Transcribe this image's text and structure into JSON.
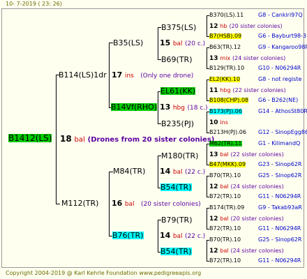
{
  "header": {
    "date": "10-  7-2019 ( 23: 26)"
  },
  "footer": {
    "copyright": "Copyright 2004-2019 @ Karl Kehrle Foundation    www.pedigreeapis.org"
  },
  "colors": {
    "yellow": "#ffff00",
    "green": "#00cc00",
    "cyan": "#00ffff",
    "info_red": "#cc0000",
    "info_purple": "#5a00a0",
    "right_blue": "#0000cc"
  },
  "gen1": {
    "name": "B1412(LS)",
    "num": "18",
    "sep": "bal",
    "note": "(Drones from 20 sister colonies)"
  },
  "gen2": [
    {
      "name": "B114(LS)1dr",
      "num": "17",
      "sep": "ins",
      "note": "(Only one drone)"
    },
    {
      "name": "M112(TR)",
      "num": "16",
      "sep": "bal",
      "note": "(20 sister colonies)"
    }
  ],
  "gen3": [
    {
      "name": "B35(LS)",
      "num": "15",
      "sep": "bal",
      "note": "(20 c.)"
    },
    {
      "name": "B14Vf(RHO)",
      "num": "13",
      "sep": "hbg",
      "note": "(18 c.)"
    },
    {
      "name": "M84(TR)",
      "num": "14",
      "sep": "bal",
      "note": "(22 c.)"
    },
    {
      "name": "B76(TR)",
      "num": "14",
      "sep": "bal",
      "note": "(22 c.)"
    }
  ],
  "gen4": [
    {
      "name": "B375(LS)",
      "num": "12",
      "sep": "hb",
      "note": "(20 sister colonies)"
    },
    {
      "name": "B69(TR)",
      "num": "13",
      "sep": "mix",
      "note": "(24 sister colonies)"
    },
    {
      "name": "EL61(KK)",
      "num": "11",
      "sep": "hbg",
      "note": "(22 sister colonies)"
    },
    {
      "name": "B235(PJ)",
      "num": "10",
      "sep": "ins",
      "note": ""
    },
    {
      "name": "M180(TR)",
      "num": "13",
      "sep": "bal",
      "note": "(22 sister colonies)"
    },
    {
      "name": "B54(TR)",
      "num": "12",
      "sep": "bal",
      "note": "(24 sister colonies)"
    },
    {
      "name": "B79(TR)",
      "num": "12",
      "sep": "bal",
      "note": "(20 sister colonies)"
    },
    {
      "name": "B54(TR)",
      "num": "12",
      "sep": "bal",
      "note": "(24 sister colonies)"
    }
  ],
  "gen5": [
    {
      "name": "B370(LS).11",
      "right": "G8 - Cankiri97Q"
    },
    {
      "name": "B7(HSB).09",
      "right": "G6 - Bayburt98-3"
    },
    {
      "name": "B63(TR).12",
      "right": "G9 - Kangaroo98R"
    },
    {
      "name": "B129(TR).10",
      "right": "G10 - N06294R"
    },
    {
      "name": "EL2(KK).10",
      "right": "G8 - not registe"
    },
    {
      "name": "B108(CHP).08",
      "right": "G6 - B262(NE)"
    },
    {
      "name": "B173(PJ).06",
      "right": "G14 - AthosSt80R"
    },
    {
      "name": "B213H(PJ).06",
      "right": "G12 - SinopEgg86R"
    },
    {
      "name": "M62(TR).11",
      "right": "G1 - KilimandQ"
    },
    {
      "name": "B47(MKK).09",
      "right": "G23 - Sinop62R"
    },
    {
      "name": "B70(TR).10",
      "right": "G25 - Sinop62R"
    },
    {
      "name": "B72(TR).10",
      "right": "G11 - N06294R"
    },
    {
      "name": "B174(TR).09",
      "right": "G9 - Takab93aR"
    },
    {
      "name": "B72(TR).10",
      "right": "G11 - N06294R"
    },
    {
      "name": "B70(TR).10",
      "right": "G25 - Sinop62R"
    },
    {
      "name": "B72(TR).10",
      "right": "G11 - N06294R"
    }
  ]
}
